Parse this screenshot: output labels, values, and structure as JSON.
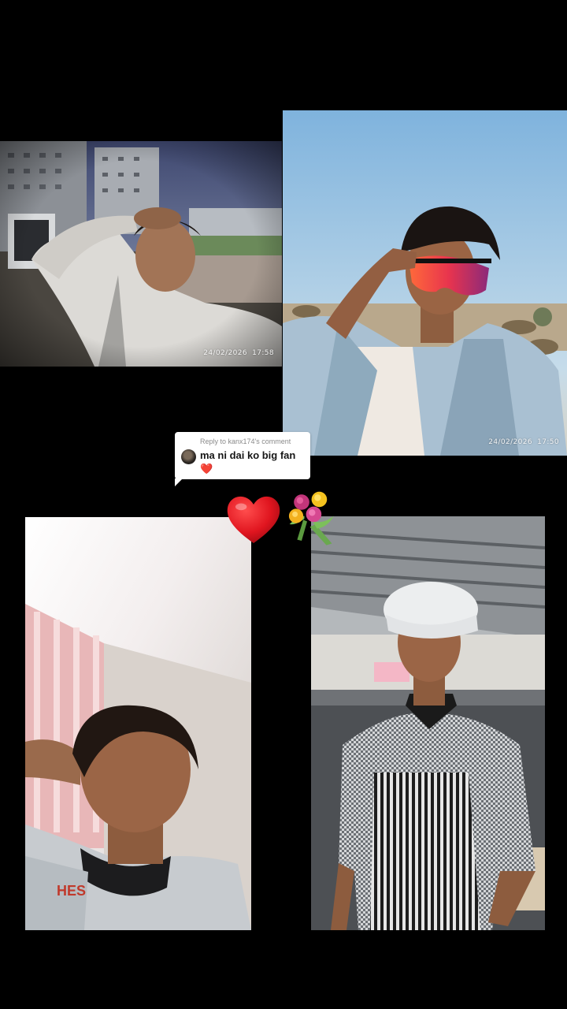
{
  "reply_bubble": {
    "reply_label": "Reply to kanx174's comment",
    "comment_text": "ma ni dai ko big fan❤️"
  },
  "photos": [
    {
      "name": "photo-rooftop-selfie",
      "date": "24/02/2026",
      "time": "17:58"
    },
    {
      "name": "photo-sunglasses-denim",
      "date": "24/02/2026",
      "time": "17:50"
    },
    {
      "name": "photo-closeup-selfie"
    },
    {
      "name": "photo-chef-kitchen"
    }
  ],
  "stickers": {
    "heart": "heart-icon",
    "bouquet": "bouquet-icon"
  },
  "colors": {
    "background": "#000000",
    "heart": "#e0151f",
    "bubble": "#ffffff"
  }
}
